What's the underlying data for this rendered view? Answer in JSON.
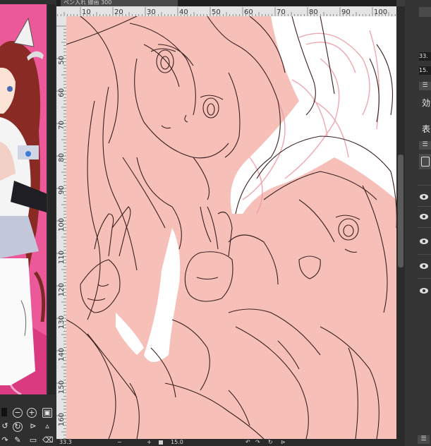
{
  "document_tab": {
    "title": "ペン入れ 線画 300"
  },
  "ruler_top": {
    "ticks": [
      "10",
      "20",
      "30",
      "40",
      "50",
      "60",
      "70",
      "80",
      "90",
      "100"
    ]
  },
  "ruler_left": {
    "ticks": [
      "50",
      "60",
      "70",
      "80",
      "90",
      "100",
      "110",
      "120",
      "130",
      "140",
      "150",
      "160",
      "170"
    ]
  },
  "status_bar": {
    "zoom": "33.3",
    "rotation": "15.0"
  },
  "right_panel": {
    "field_1": "33.",
    "field_2": "15.",
    "label_effect": "効",
    "label_display": "表"
  },
  "colors": {
    "canvas_fill": "#f6bfb8",
    "line_art": "#3a2020",
    "rough_sketch": "#ee9da6",
    "reference_bg": "#e8488e"
  },
  "icons": [
    "zoom-out-icon",
    "zoom-in-icon",
    "fit-window-icon",
    "rotate-icon",
    "flip-icon",
    "folder-icon",
    "trash-icon",
    "eye-icon"
  ]
}
